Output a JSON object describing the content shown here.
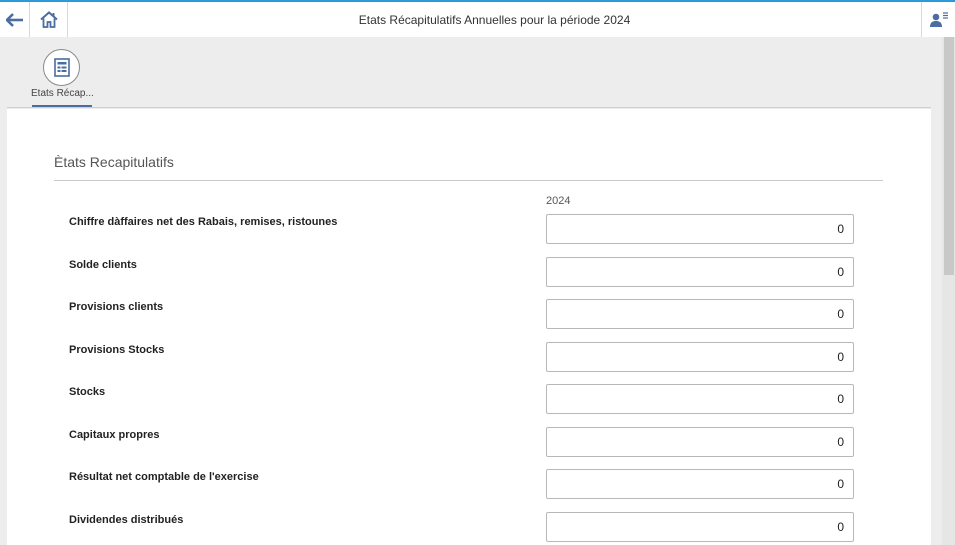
{
  "header": {
    "title": "Etats Récapitulatifs Annuelles pour la période 2024",
    "back_icon": "arrow-left-icon",
    "home_icon": "home-icon",
    "user_icon": "user-menu-icon"
  },
  "tabs": [
    {
      "label": "Etats Récap...",
      "icon": "document-form-icon",
      "active": true
    }
  ],
  "section": {
    "title": "Ètats Recapitulatifs",
    "year_header": "2024"
  },
  "rows": [
    {
      "label": "Chiffre dàffaires net des Rabais, remises, ristounes",
      "value": "0"
    },
    {
      "label": "Solde clients",
      "value": "0"
    },
    {
      "label": "Provisions clients",
      "value": "0"
    },
    {
      "label": "Provisions Stocks",
      "value": "0"
    },
    {
      "label": "Stocks",
      "value": "0"
    },
    {
      "label": "Capitaux propres",
      "value": "0"
    },
    {
      "label": "Résultat net comptable de l'exercise",
      "value": "0"
    },
    {
      "label": "Dividendes distribués",
      "value": "0"
    }
  ],
  "colors": {
    "accent": "#2a9bd8",
    "tab_underline": "#4a6ea0",
    "icon": "#4a6ea0"
  }
}
